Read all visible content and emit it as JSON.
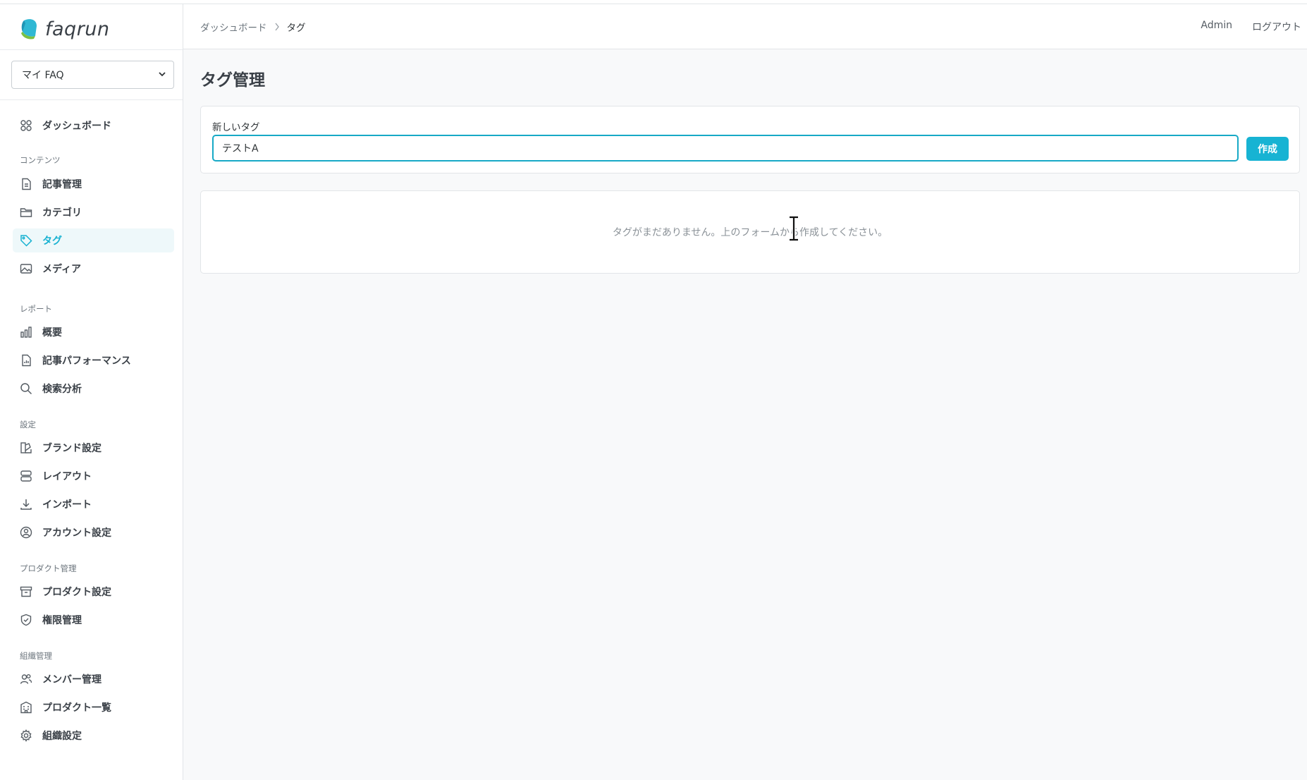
{
  "app": {
    "logo_text": "faqrun",
    "brand_color": "#17b3d3"
  },
  "faq_select": {
    "value": "マイ FAQ"
  },
  "sidebar": {
    "dashboard": "ダッシュボード",
    "sections": {
      "content": "コンテンツ",
      "report": "レポート",
      "settings": "設定",
      "product_mgmt": "プロダクト管理",
      "org_mgmt": "組織管理"
    },
    "items": {
      "articles": "記事管理",
      "categories": "カテゴリ",
      "tags": "タグ",
      "media": "メディア",
      "overview": "概要",
      "article_performance": "記事パフォーマンス",
      "search_analysis": "検索分析",
      "brand_settings": "ブランド設定",
      "layout": "レイアウト",
      "import": "インポート",
      "account_settings": "アカウント設定",
      "product_settings": "プロダクト設定",
      "permissions": "権限管理",
      "members": "メンバー管理",
      "product_list": "プロダクト一覧",
      "org_settings": "組織設定"
    },
    "active": "tags"
  },
  "header": {
    "breadcrumb": {
      "parent": "ダッシュボード",
      "current": "タグ"
    },
    "user": "Admin",
    "logout": "ログアウト"
  },
  "main": {
    "title": "タグ管理",
    "form": {
      "label": "新しいタグ",
      "input_value": "テストA",
      "create_label": "作成"
    },
    "empty_message": "タグがまだありません。上のフォームから作成してください。"
  }
}
